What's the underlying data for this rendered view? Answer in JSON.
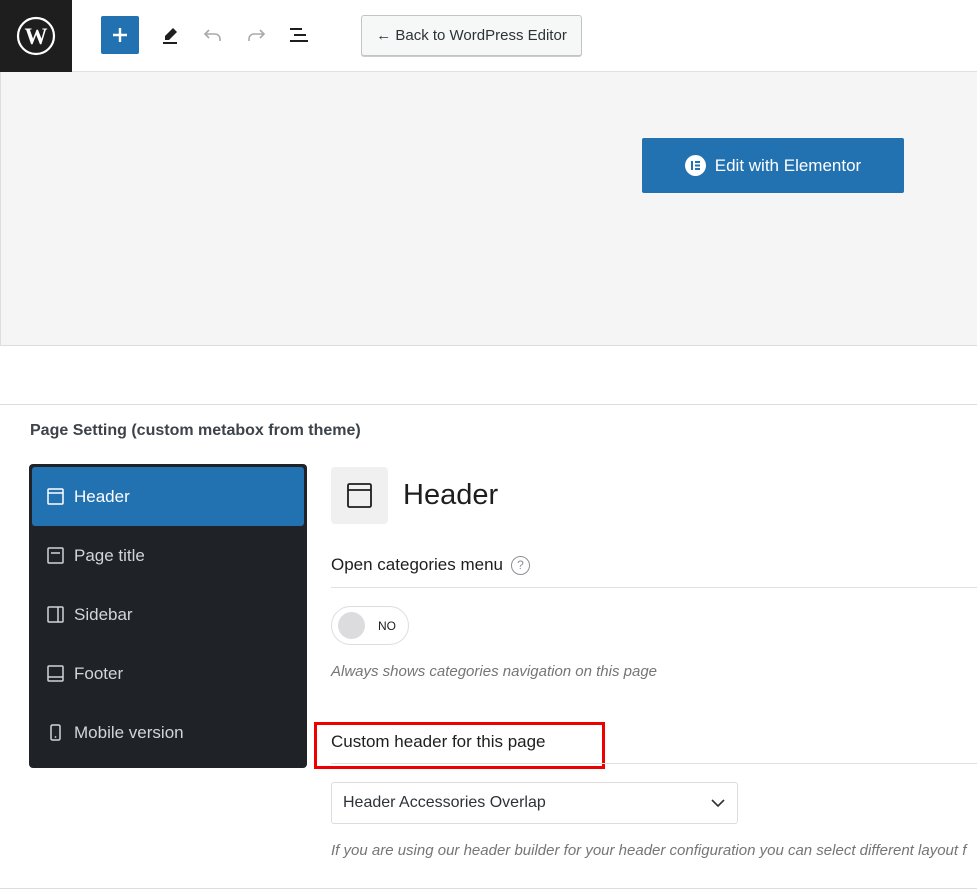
{
  "toolbar": {
    "logo_icon": "wordpress-logo-icon",
    "add_icon": "plus-icon",
    "tools_icon": "pencil-icon",
    "undo_icon": "undo-icon",
    "redo_icon": "redo-icon",
    "list_view_icon": "list-view-icon",
    "back_button_label": "← Back to WordPress Editor"
  },
  "canvas": {
    "elementor_button_label": "Edit with Elementor",
    "elementor_icon": "elementor-icon"
  },
  "metabox": {
    "title": "Page Setting (custom metabox from theme)",
    "nav_items": [
      {
        "label": "Header",
        "icon": "header-layout-icon",
        "active": true
      },
      {
        "label": "Page title",
        "icon": "page-title-icon",
        "active": false
      },
      {
        "label": "Sidebar",
        "icon": "sidebar-layout-icon",
        "active": false
      },
      {
        "label": "Footer",
        "icon": "footer-layout-icon",
        "active": false
      },
      {
        "label": "Mobile version",
        "icon": "mobile-icon",
        "active": false
      }
    ],
    "panel": {
      "title": "Header",
      "icon": "header-layout-icon",
      "fields": [
        {
          "label": "Open categories menu",
          "help_icon": "question-icon",
          "help_text": "?",
          "toggle_value": "NO",
          "description": "Always shows categories navigation on this page"
        },
        {
          "label": "Custom header for this page",
          "select_value": "Header Accessories Overlap",
          "description": "If you are using our header builder for your header configuration you can select different layout f"
        }
      ]
    }
  },
  "colors": {
    "accent": "#2271b1",
    "nav_bg": "#1f2327",
    "highlight": "#ee0000"
  }
}
